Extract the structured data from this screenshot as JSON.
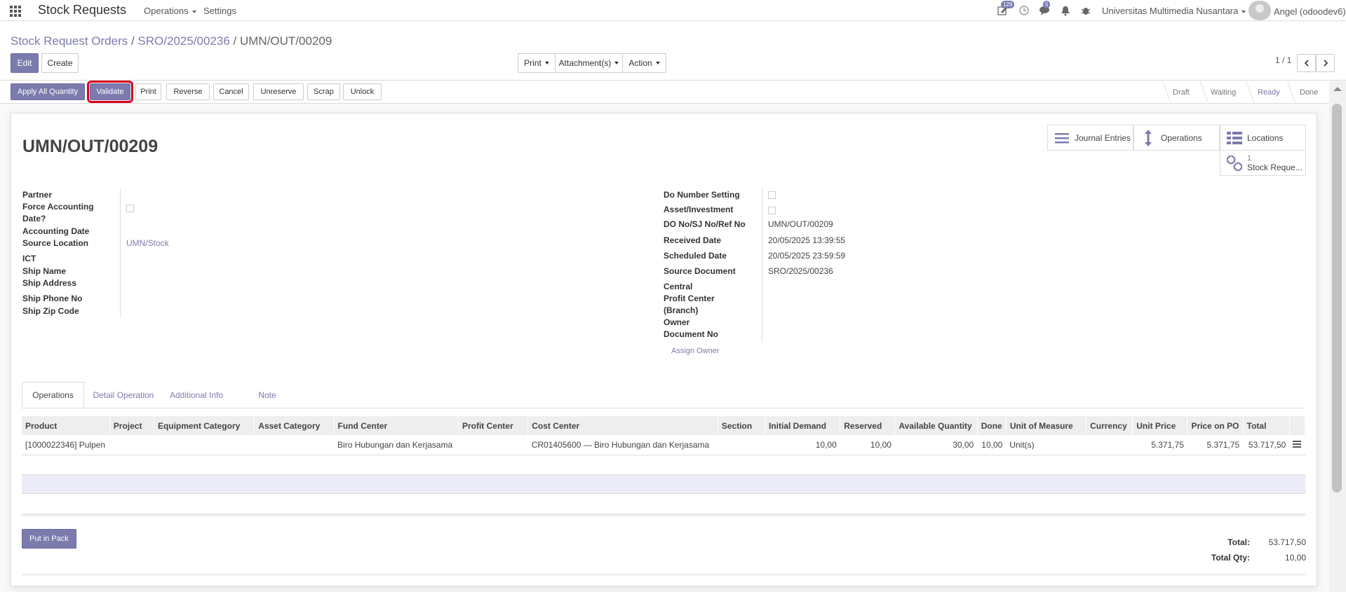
{
  "topbar": {
    "brand": "Stock Requests",
    "menu": [
      "Operations",
      "Settings"
    ],
    "badges": {
      "activity": "129",
      "discuss": "5"
    },
    "company": "Universitas Multimedia Nusantara",
    "user": "Angel (odoodev6)"
  },
  "breadcrumb": [
    "Stock Request Orders",
    "SRO/2025/00236",
    "UMN/OUT/00209"
  ],
  "controls": {
    "edit": "Edit",
    "create": "Create",
    "print": "Print",
    "attachments": "Attachment(s)",
    "action": "Action",
    "pager": "1 / 1"
  },
  "statusbar": {
    "buttons": [
      "Apply All Quantity",
      "Validate",
      "Print",
      "Reverse",
      "Cancel",
      "Unreserve",
      "Scrap",
      "Unlock"
    ],
    "stages": [
      "Draft",
      "Waiting",
      "Ready",
      "Done"
    ],
    "active_stage": "Ready"
  },
  "smart_buttons": {
    "journal": "Journal Entries",
    "operations": "Operations",
    "locations": "Locations",
    "stock_req_count": "1",
    "stock_req_label": "Stock Reque..."
  },
  "form": {
    "name": "UMN/OUT/00209",
    "left": {
      "partner": "Partner",
      "force_acc_1": "Force Accounting",
      "force_acc_2": "Date?",
      "acc_date": "Accounting Date",
      "source_loc": "Source Location",
      "source_loc_val": "UMN/Stock",
      "ict": "ICT",
      "ship_name": "Ship Name",
      "ship_address": "Ship Address",
      "ship_phone": "Ship Phone No",
      "ship_zip": "Ship Zip Code"
    },
    "right": {
      "do_setting": "Do Number Setting",
      "asset": "Asset/Investment",
      "do_no": "DO No/SJ No/Ref No",
      "do_no_val": "UMN/OUT/00209",
      "received": "Received Date",
      "received_val": "20/05/2025 13:39:55",
      "scheduled": "Scheduled Date",
      "scheduled_val": "20/05/2025 23:59:59",
      "source_doc": "Source Document",
      "source_doc_val": "SRO/2025/00236",
      "central": "Central",
      "profit_1": "Profit Center",
      "profit_2": "(Branch)",
      "owner": "Owner",
      "doc_no": "Document No",
      "assign_owner": "Assign Owner"
    }
  },
  "tabs": [
    "Operations",
    "Detail Operation",
    "Additional Info",
    "Note"
  ],
  "table": {
    "headers": [
      "Product",
      "Project",
      "Equipment Category",
      "Asset Category",
      "Fund Center",
      "Profit Center",
      "Cost Center",
      "Section",
      "Initial Demand",
      "Reserved",
      "Available Quantity",
      "Done",
      "Unit of Measure",
      "Currency",
      "Unit Price",
      "Price on PO",
      "Total"
    ],
    "rows": [
      [
        "[1000022346] Pulpen",
        "",
        "",
        "",
        "Biro Hubungan dan Kerjasama",
        "",
        "CR01405600 — Biro Hubungan dan Kerjasama",
        "",
        "10,00",
        "10,00",
        "30,00",
        "10,00",
        "Unit(s)",
        "",
        "5.371,75",
        "5.371,75",
        "53.717,50"
      ]
    ]
  },
  "footer": {
    "put_in_pack": "Put in Pack",
    "total_label": "Total:",
    "total_val": "53.717,50",
    "qty_label": "Total Qty:",
    "qty_val": "10,00"
  },
  "colors": {
    "accent": "#7c7bad",
    "highlight": "#d9001b"
  }
}
